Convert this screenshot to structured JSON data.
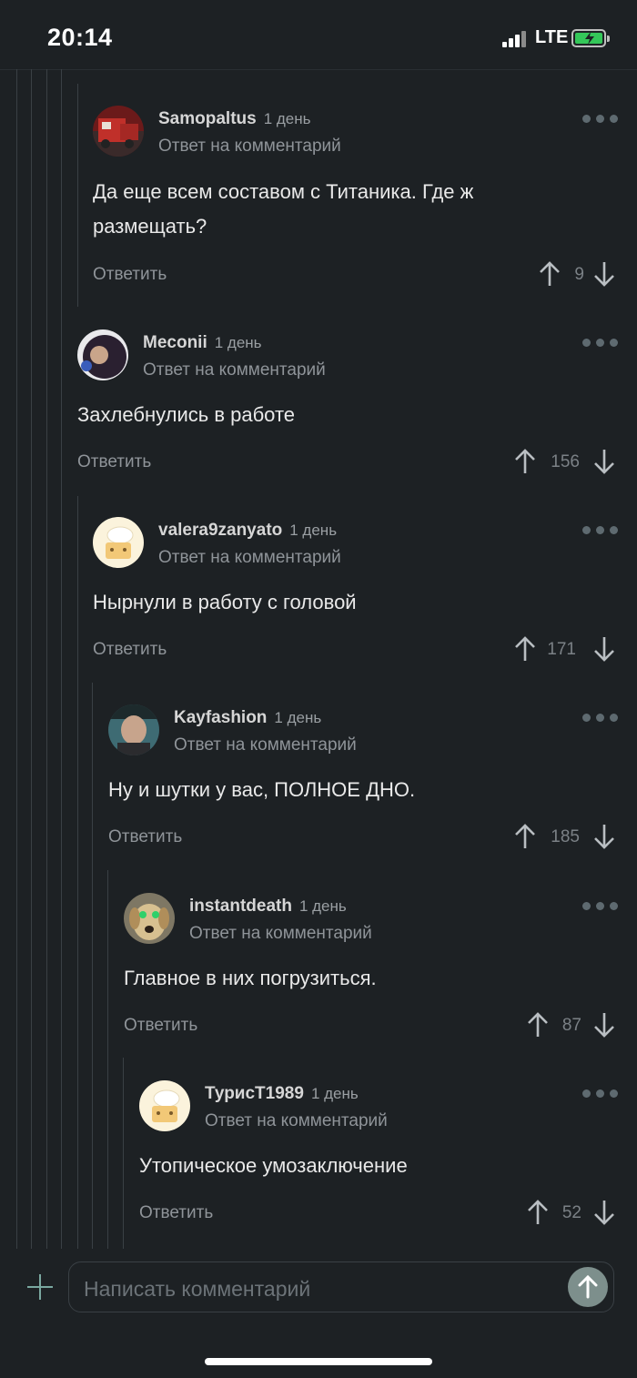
{
  "status_bar": {
    "time": "20:14",
    "network": "LTE"
  },
  "reply_label": "Ответить",
  "comments": [
    {
      "author": "Samopaltus",
      "date": "1 день",
      "subline": "Ответ на комментарий",
      "text_lines": [
        "Да еще всем составом с Титаника. Где ж",
        "размещать?"
      ],
      "reply": "Ответить",
      "votes": "9"
    },
    {
      "author": "Meconii",
      "date": "1 день",
      "subline": "Ответ на комментарий",
      "text_lines": [
        "Захлебнулись в работе"
      ],
      "reply": "Ответить",
      "votes": "156"
    },
    {
      "author": "valera9zanyato",
      "date": "1 день",
      "subline": "Ответ на комментарий",
      "text_lines": [
        "Нырнули в работу с головой"
      ],
      "reply": "Ответить",
      "votes": "171"
    },
    {
      "author": "Kayfashion",
      "date": "1 день",
      "subline": "Ответ на комментарий",
      "text_lines": [
        "Ну и шутки у вас, ПОЛНОЕ ДНО."
      ],
      "reply": "Ответить",
      "votes": "185"
    },
    {
      "author": "instantdeath",
      "date": "1 день",
      "subline": "Ответ на комментарий",
      "text_lines": [
        "Главное в них погрузиться."
      ],
      "reply": "Ответить",
      "votes": "87"
    },
    {
      "author": "ТурисТ1989",
      "date": "1 день",
      "subline": "Ответ на комментарий",
      "text_lines": [
        "Утопическое умозаключение"
      ],
      "reply": "Ответить",
      "votes": "52"
    }
  ],
  "composer": {
    "placeholder": "Написать комментарий"
  },
  "icons": {
    "more": "more-dots-icon",
    "upvote": "arrow-up-icon",
    "downvote": "arrow-down-icon",
    "add": "plus-icon",
    "send": "send-arrow-icon"
  },
  "colors": {
    "background": "#1d2124",
    "accent": "#7aa8a0",
    "muted": "#8f9499"
  }
}
